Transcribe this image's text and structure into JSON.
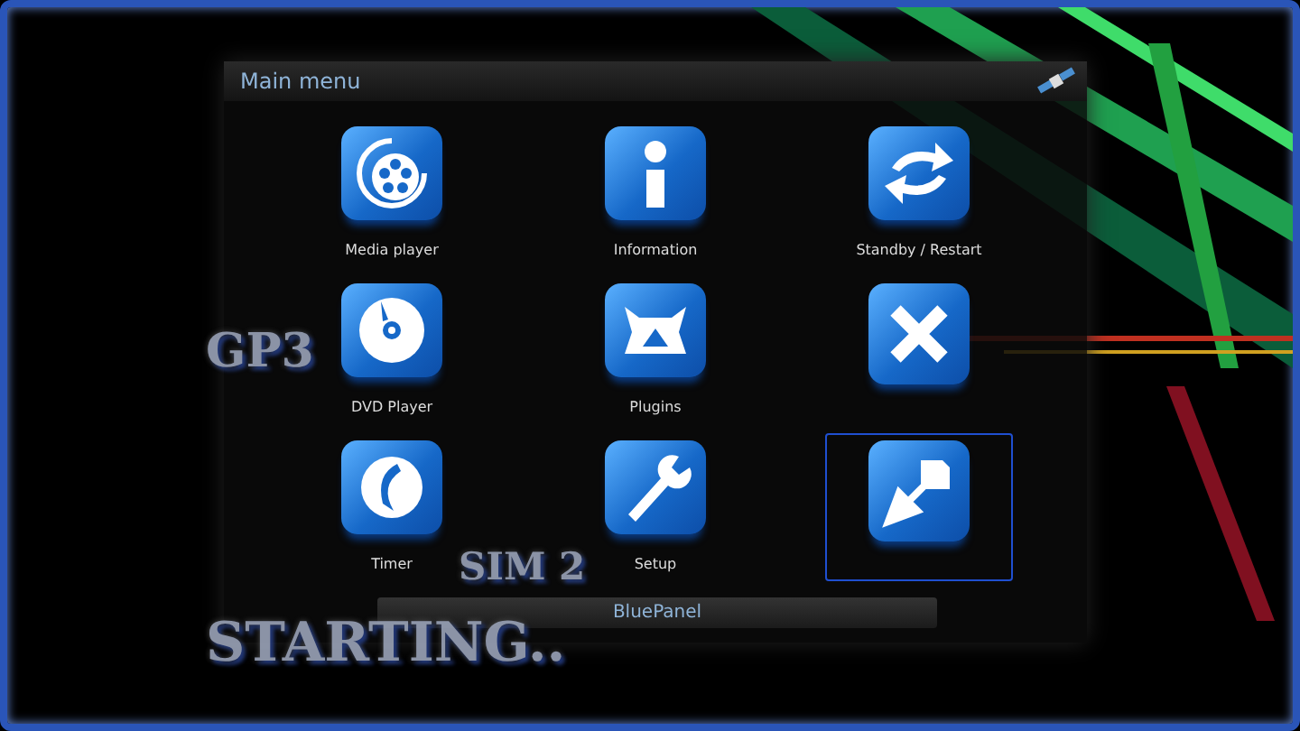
{
  "window": {
    "title": "Main menu"
  },
  "items": [
    {
      "kind": "film",
      "label": "Media player",
      "selected": false
    },
    {
      "kind": "info",
      "label": "Information",
      "selected": false
    },
    {
      "kind": "refresh",
      "label": "Standby / Restart",
      "selected": false
    },
    {
      "kind": "disc",
      "label": "DVD Player",
      "selected": false
    },
    {
      "kind": "plugin",
      "label": "Plugins",
      "selected": false
    },
    {
      "kind": "close",
      "selected": false
    },
    {
      "kind": "timer",
      "label": "Timer",
      "selected": false
    },
    {
      "kind": "wrench",
      "label": "Setup",
      "selected": false
    },
    {
      "kind": "arrow",
      "selected": true
    }
  ],
  "status_bar": {
    "text": "BluePanel"
  },
  "overlay": [
    "GP3",
    "SIM 2",
    "STARTING.."
  ]
}
